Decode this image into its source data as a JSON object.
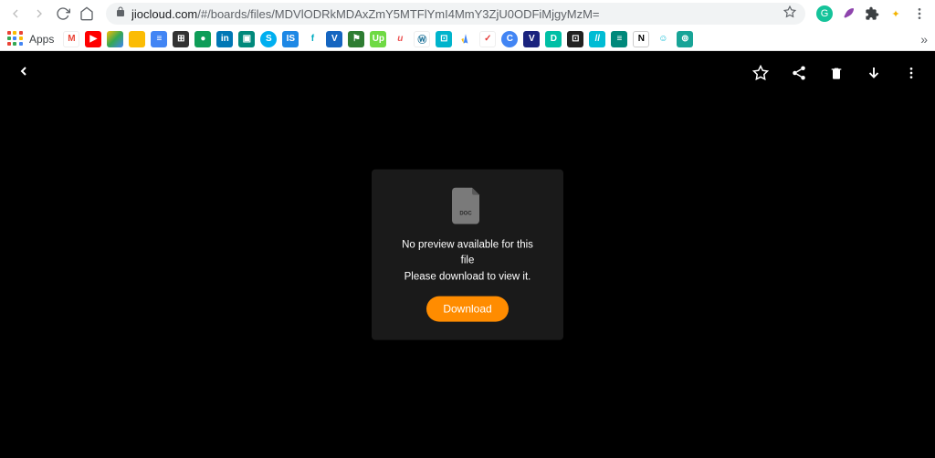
{
  "browser": {
    "url_domain": "jiocloud.com",
    "url_path": "/#/boards/files/MDVlODRkMDAxZmY5MTFlYmI4MmY3ZjU0ODFiMjgyMzM=",
    "apps_label": "Apps"
  },
  "viewer": {
    "preview_line1": "No preview available for this file",
    "preview_line2": "Please download to view it.",
    "download_label": "Download",
    "doc_badge": "DOC"
  }
}
